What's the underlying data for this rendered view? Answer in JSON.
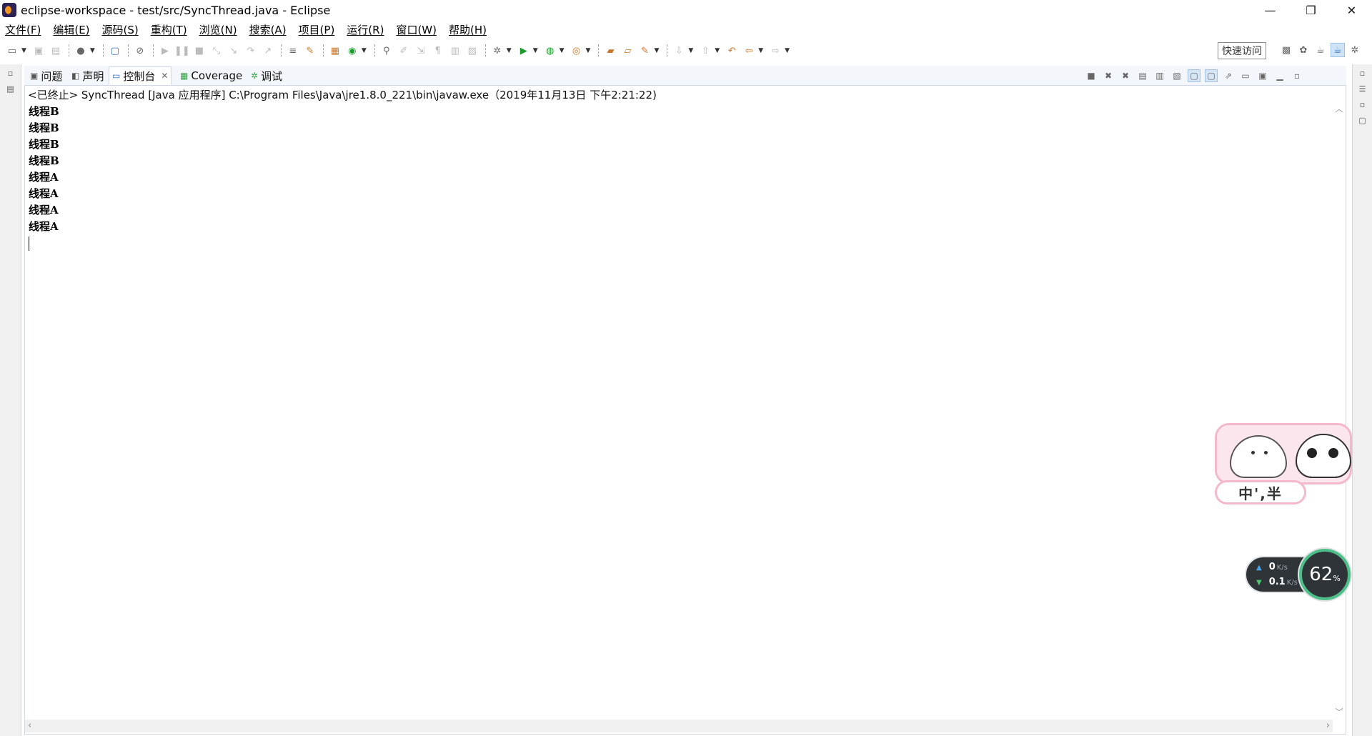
{
  "window": {
    "title": "eclipse-workspace - test/src/SyncThread.java - Eclipse",
    "minimize": "—",
    "restore": "❐",
    "close": "✕"
  },
  "menu": [
    "文件(F)",
    "编辑(E)",
    "源码(S)",
    "重构(T)",
    "浏览(N)",
    "搜索(A)",
    "项目(P)",
    "运行(R)",
    "窗口(W)",
    "帮助(H)"
  ],
  "toolbar": {
    "quick_access": "快速访问"
  },
  "view_tabs": {
    "problems": "问题",
    "declaration": "声明",
    "console": "控制台",
    "coverage": "Coverage",
    "debug": "调试"
  },
  "console": {
    "header": "<已终止> SyncThread [Java 应用程序] C:\\Program Files\\Java\\jre1.8.0_221\\bin\\javaw.exe（2019年11月13日 下午2:21:22)",
    "lines": [
      "线程B",
      "线程B",
      "线程B",
      "线程B",
      "线程A",
      "线程A",
      "线程A",
      "线程A"
    ]
  },
  "ime": {
    "status": "中',半"
  },
  "net_monitor": {
    "upload": "0",
    "download": "0.1",
    "unit": "K/s",
    "percent": "62",
    "percent_unit": "%"
  },
  "colors": {
    "accent": "#3b6db5",
    "run_green": "#1a9c2a",
    "ring_green": "#4fbf8a"
  }
}
